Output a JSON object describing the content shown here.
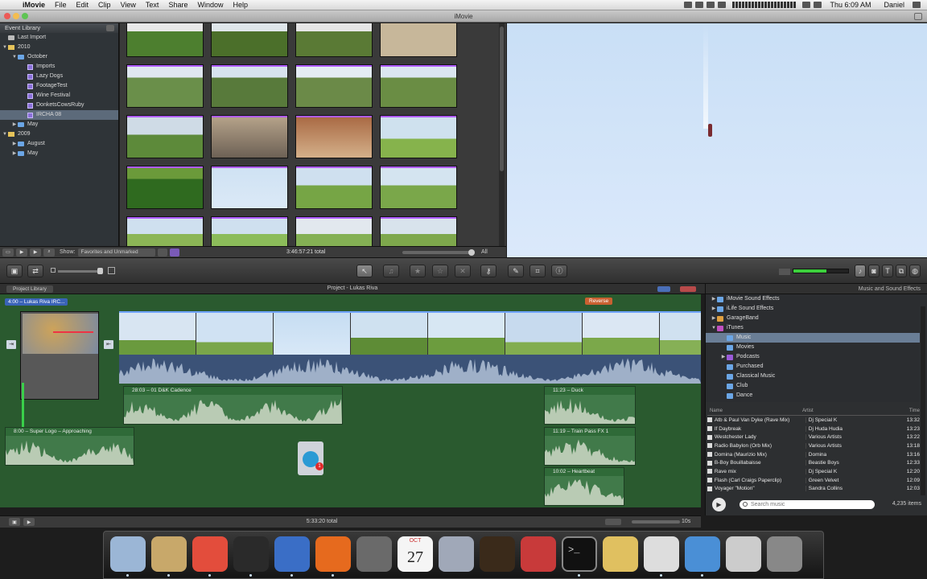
{
  "menubar": {
    "app": "iMovie",
    "menus": [
      "File",
      "Edit",
      "Clip",
      "View",
      "Text",
      "Share",
      "Window",
      "Help"
    ],
    "clock": "Thu 6:09 AM",
    "user": "Daniel"
  },
  "window": {
    "title": "iMovie"
  },
  "event_library": {
    "header": "Event Library",
    "items": [
      {
        "label": "Last Import",
        "level": 0,
        "kind": "special"
      },
      {
        "label": "2010",
        "level": 0,
        "kind": "year",
        "expanded": true
      },
      {
        "label": "October",
        "level": 1,
        "kind": "folder",
        "expanded": true
      },
      {
        "label": "Imports",
        "level": 2,
        "kind": "event"
      },
      {
        "label": "Lazy Dogs",
        "level": 2,
        "kind": "event"
      },
      {
        "label": "FootageTest",
        "level": 2,
        "kind": "event"
      },
      {
        "label": "Wine Festival",
        "level": 2,
        "kind": "event"
      },
      {
        "label": "DonketsCowsRuby",
        "level": 2,
        "kind": "event"
      },
      {
        "label": "IRCHA 08",
        "level": 2,
        "kind": "event",
        "selected": true
      },
      {
        "label": "May",
        "level": 1,
        "kind": "folder"
      },
      {
        "label": "2009",
        "level": 0,
        "kind": "year",
        "expanded": true
      },
      {
        "label": "August",
        "level": 1,
        "kind": "folder"
      },
      {
        "label": "May",
        "level": 1,
        "kind": "folder"
      }
    ]
  },
  "browser": {
    "show_label": "Show:",
    "show_value": "Favorites and Unmarked",
    "total": "3:46:57:21 total",
    "all_label": "All"
  },
  "toolbar": {
    "buttons": [
      "import-camera",
      "import-swap",
      "select",
      "audio-adjust",
      "favorite",
      "unmark",
      "reject",
      "keyword",
      "crop-tool",
      "crop",
      "inspector"
    ]
  },
  "project": {
    "library_button": "Project Library",
    "title": "Project - Lukas Riva",
    "map_clip_label": "4:00 – Lukas Riva IRC...",
    "reverse_label": "Reverse",
    "audio_clips": [
      {
        "label": "28:03 – 01 D&K Cadence"
      },
      {
        "label": "8:00 – Super Logo – Approaching"
      },
      {
        "label": "11:23 – Duck"
      },
      {
        "label": "11:19 – Train Pass FX 1"
      },
      {
        "label": "10:02 – Heartbeat"
      }
    ],
    "itunes_badge": "1",
    "total": "5:33:20 total",
    "zoom": "10s"
  },
  "music_panel": {
    "title": "Music and Sound Effects",
    "sources": [
      {
        "label": "iMovie Sound Effects",
        "level": 0
      },
      {
        "label": "iLife Sound Effects",
        "level": 0
      },
      {
        "label": "GarageBand",
        "level": 0
      },
      {
        "label": "iTunes",
        "level": 0
      },
      {
        "label": "Music",
        "level": 1,
        "selected": true
      },
      {
        "label": "Movies",
        "level": 1
      },
      {
        "label": "Podcasts",
        "level": 1
      },
      {
        "label": "Purchased",
        "level": 1
      },
      {
        "label": "Classical Music",
        "level": 1
      },
      {
        "label": "Club",
        "level": 1
      },
      {
        "label": "Dance",
        "level": 1
      }
    ],
    "columns": {
      "name": "Name",
      "artist": "Artist",
      "time": "Time"
    },
    "songs": [
      {
        "name": "Atb & Paul Van Dyke (Rave Mix)",
        "artist": "Dj Special K",
        "time": "13:32"
      },
      {
        "name": "If Daybreak",
        "artist": "Dj Huda Hudia",
        "time": "13:23"
      },
      {
        "name": "Westchester Lady",
        "artist": "Various Artists",
        "time": "13:22"
      },
      {
        "name": "Radio Babylon (Orb Mix)",
        "artist": "Various Artists",
        "time": "13:18"
      },
      {
        "name": "Domina (Maurizio Mix)",
        "artist": "Domina",
        "time": "13:16"
      },
      {
        "name": "B-Boy Bouillabaisse",
        "artist": "Beastie Boys",
        "time": "12:33"
      },
      {
        "name": "Rave mix",
        "artist": "Dj Special K",
        "time": "12:20"
      },
      {
        "name": "Flash (Carl Craigs Paperclip)",
        "artist": "Green Velvet",
        "time": "12:09"
      },
      {
        "name": "Voyager \"Motion\"",
        "artist": "Sandra Collins",
        "time": "12:03"
      }
    ],
    "search_placeholder": "Search music",
    "items_count": "4,235 items"
  },
  "dock": {
    "calendar_month": "OCT",
    "calendar_day": "27",
    "apps": [
      "finder-icon",
      "mail-icon",
      "chrome-icon",
      "imovie-icon",
      "clapper-icon",
      "firefox-icon",
      "fcp-icon",
      "ical-icon",
      "aperture-icon",
      "garageband-icon",
      "photobooth-icon",
      "terminal-icon",
      "preview-icon",
      "textedit-icon",
      "safari-icon",
      "documents-icon",
      "trash-icon"
    ]
  },
  "colors": {
    "accent_purple": "#b05cff",
    "timeline_green": "#2a5a2f",
    "selection_blue": "#6a7e96",
    "level_green": "#3cd03c"
  }
}
